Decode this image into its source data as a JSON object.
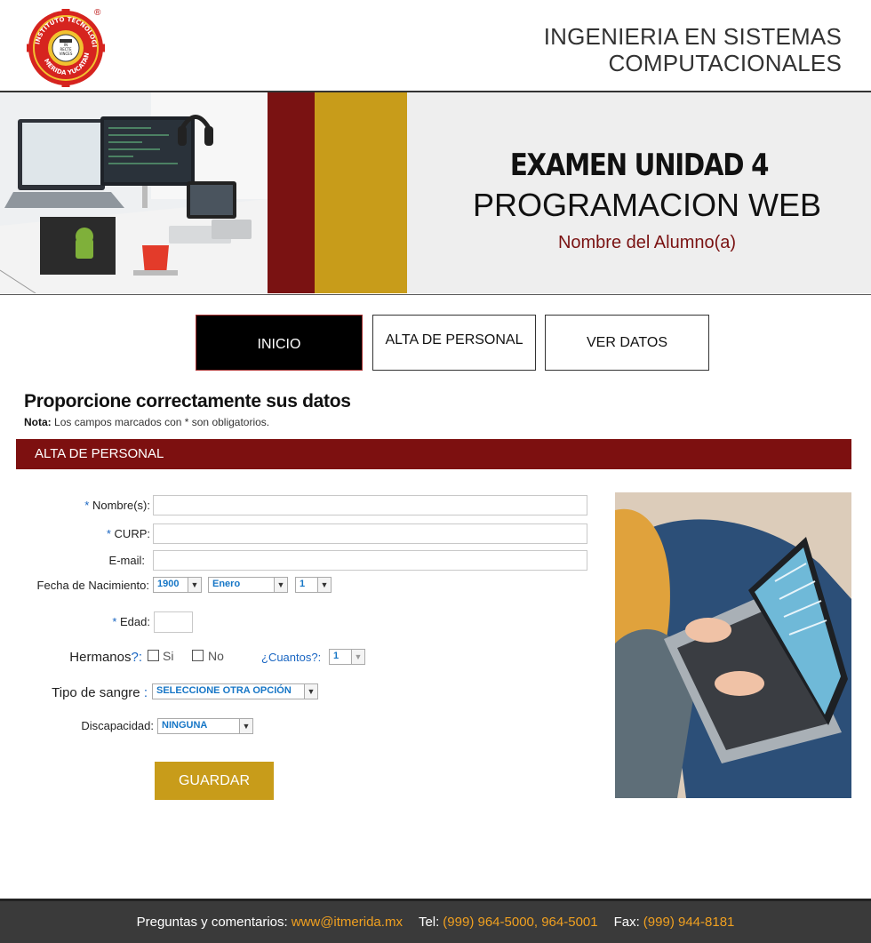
{
  "header": {
    "logo_icon": "instituto-tecnologico-merida-seal-icon",
    "logo_text": {
      "arc_top": "INSTITUTO TECNOLOGICO",
      "arc_bottom": "MERIDA YUCATAN",
      "center_lines": [
        "IN",
        "RECTE",
        "VINCES"
      ]
    },
    "reg_mark": "®",
    "career_line1": "INGENIERIA EN SISTEMAS",
    "career_line2": "COMPUTACIONALES"
  },
  "banner": {
    "title": "EXAMEN UNIDAD 4",
    "subtitle": "PROGRAMACION WEB",
    "student": "Nombre del Alumno(a)",
    "colors": {
      "red": "#7a1212",
      "gold": "#c89c1a",
      "panel": "#eeeeee"
    }
  },
  "nav": {
    "tabs": [
      {
        "label": "INICIO",
        "active": true
      },
      {
        "label": "ALTA DE PERSONAL",
        "active": false
      },
      {
        "label": "VER DATOS",
        "active": false
      }
    ]
  },
  "form": {
    "heading": "Proporcione correctamente sus datos",
    "note_label": "Nota:",
    "note_text": "Los campos marcados con * son obligatorios.",
    "section_title": "ALTA DE PERSONAL",
    "fields": {
      "nombre": {
        "req": "*",
        "label": "Nombre(s):",
        "value": ""
      },
      "curp": {
        "req": "*",
        "label": "CURP:",
        "value": ""
      },
      "email": {
        "label": "E-mail:",
        "value": ""
      },
      "fecha": {
        "label": "Fecha de Nacimiento:",
        "year": "1900",
        "month": "Enero",
        "day": "1"
      },
      "edad": {
        "req": "*",
        "label": "Edad:",
        "value": ""
      },
      "hermanos": {
        "label": "Hermanos",
        "label_suffix": "?:",
        "opt_si": "Si",
        "opt_no": "No",
        "cuantos_label": "¿Cuantos?:",
        "cuantos_value": "1"
      },
      "sangre": {
        "label": "Tipo de sangre",
        "label_suffix": ":",
        "value": "SELECCIONE OTRA OPCIÓN"
      },
      "discapacidad": {
        "label": "Discapacidad:",
        "value": "NINGUNA"
      }
    },
    "submit_label": "GUARDAR"
  },
  "footer": {
    "questions_label": "Preguntas y comentarios:",
    "email": "www@itmerida.mx",
    "tel_label": "Tel:",
    "tel": "(999) 964-5000, 964-5001",
    "fax_label": "Fax:",
    "fax": "(999) 944-8181"
  }
}
